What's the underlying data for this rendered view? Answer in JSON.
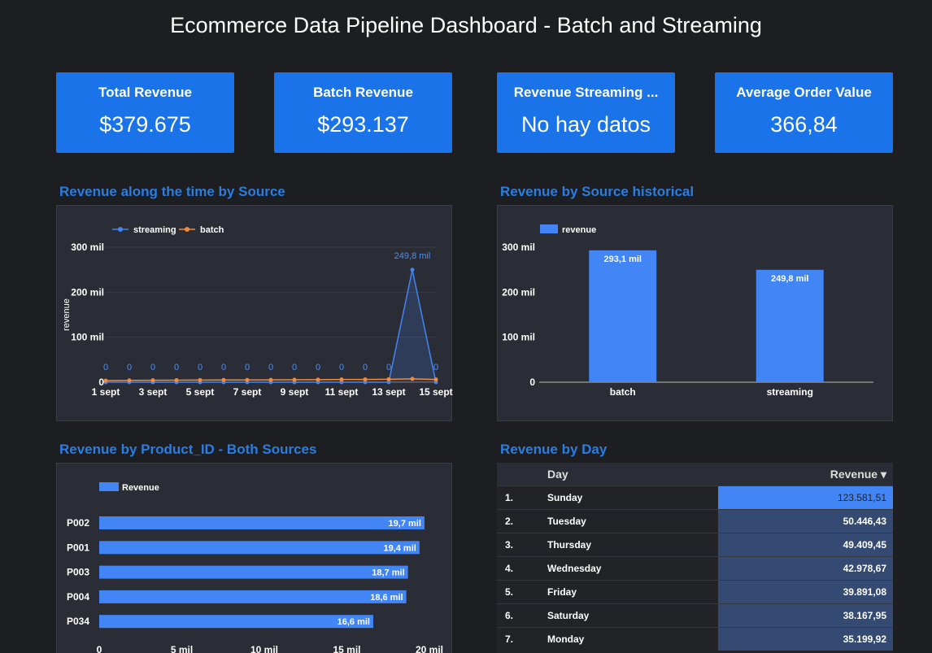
{
  "title": "Ecommerce Data Pipeline Dashboard - Batch and Streaming",
  "kpis": [
    {
      "label": "Total Revenue",
      "value": "$379.675"
    },
    {
      "label": "Batch Revenue",
      "value": "$293.137"
    },
    {
      "label": "Revenue Streaming ...",
      "value": "No hay datos"
    },
    {
      "label": "Average Order Value",
      "value": "366,84"
    }
  ],
  "sections": {
    "time": "Revenue along the time by Source",
    "historical": "Revenue by Source historical",
    "product": "Revenue by Product_ID - Both Sources",
    "day": "Revenue by Day"
  },
  "colors": {
    "accent": "#1a73e8",
    "streaming": "#4285f4",
    "batch": "#f28b3c",
    "bar": "#4285f4",
    "bg": "#1d1e21",
    "panel": "#2a2d35"
  },
  "chart_data": [
    {
      "type": "line",
      "legend_position": "top-left",
      "ylabel": "revenue",
      "ylim": [
        0,
        300000
      ],
      "y_ticks": [
        "0",
        "100 mil",
        "200 mil",
        "300 mil"
      ],
      "x_ticks": [
        "1 sept",
        "3 sept",
        "5 sept",
        "7 sept",
        "9 sept",
        "11 sept",
        "13 sept",
        "15 sept"
      ],
      "x": [
        1,
        2,
        3,
        4,
        5,
        6,
        7,
        8,
        9,
        10,
        11,
        12,
        13,
        14,
        15
      ],
      "series": [
        {
          "name": "streaming",
          "values": [
            0,
            0,
            0,
            0,
            0,
            0,
            0,
            0,
            0,
            0,
            0,
            0,
            0,
            249800,
            0
          ],
          "labels": [
            "0",
            "0",
            "0",
            "0",
            "0",
            "0",
            "0",
            "0",
            "0",
            "0",
            "0",
            "0",
            "0",
            "249,8 mil",
            "0"
          ]
        },
        {
          "name": "batch",
          "values": [
            3500,
            4000,
            4200,
            4500,
            4700,
            4900,
            5000,
            5200,
            5500,
            5700,
            6000,
            6200,
            6500,
            7500,
            6000
          ]
        }
      ]
    },
    {
      "type": "bar",
      "legend_position": "top-left",
      "ylim": [
        0,
        300000
      ],
      "y_ticks": [
        "0",
        "100 mil",
        "200 mil",
        "300 mil"
      ],
      "categories": [
        "batch",
        "streaming"
      ],
      "series": [
        {
          "name": "revenue",
          "values": [
            293100,
            249800
          ],
          "labels": [
            "293,1 mil",
            "249,8 mil"
          ]
        }
      ]
    },
    {
      "type": "bar",
      "orientation": "horizontal",
      "legend_position": "top-left",
      "xlim": [
        0,
        20000
      ],
      "x_ticks": [
        "0",
        "5 mil",
        "10 mil",
        "15 mil",
        "20 mil"
      ],
      "categories": [
        "P002",
        "P001",
        "P003",
        "P004",
        "P034"
      ],
      "series": [
        {
          "name": "Revenue",
          "values": [
            19700,
            19400,
            18700,
            18600,
            16600
          ],
          "labels": [
            "19,7 mil",
            "19,4 mil",
            "18,7 mil",
            "18,6 mil",
            "16,6 mil"
          ]
        }
      ]
    },
    {
      "type": "table",
      "columns": [
        "Day",
        "Revenue ▾"
      ],
      "rows": [
        {
          "num": "1.",
          "day": "Sunday",
          "revenue": "123.581,51",
          "value": 123581.51
        },
        {
          "num": "2.",
          "day": "Tuesday",
          "revenue": "50.446,43",
          "value": 50446.43
        },
        {
          "num": "3.",
          "day": "Thursday",
          "revenue": "49.409,45",
          "value": 49409.45
        },
        {
          "num": "4.",
          "day": "Wednesday",
          "revenue": "42.978,67",
          "value": 42978.67
        },
        {
          "num": "5.",
          "day": "Friday",
          "revenue": "39.891,08",
          "value": 39891.08
        },
        {
          "num": "6.",
          "day": "Saturday",
          "revenue": "38.167,95",
          "value": 38167.95
        },
        {
          "num": "7.",
          "day": "Monday",
          "revenue": "35.199,92",
          "value": 35199.92
        }
      ]
    }
  ]
}
